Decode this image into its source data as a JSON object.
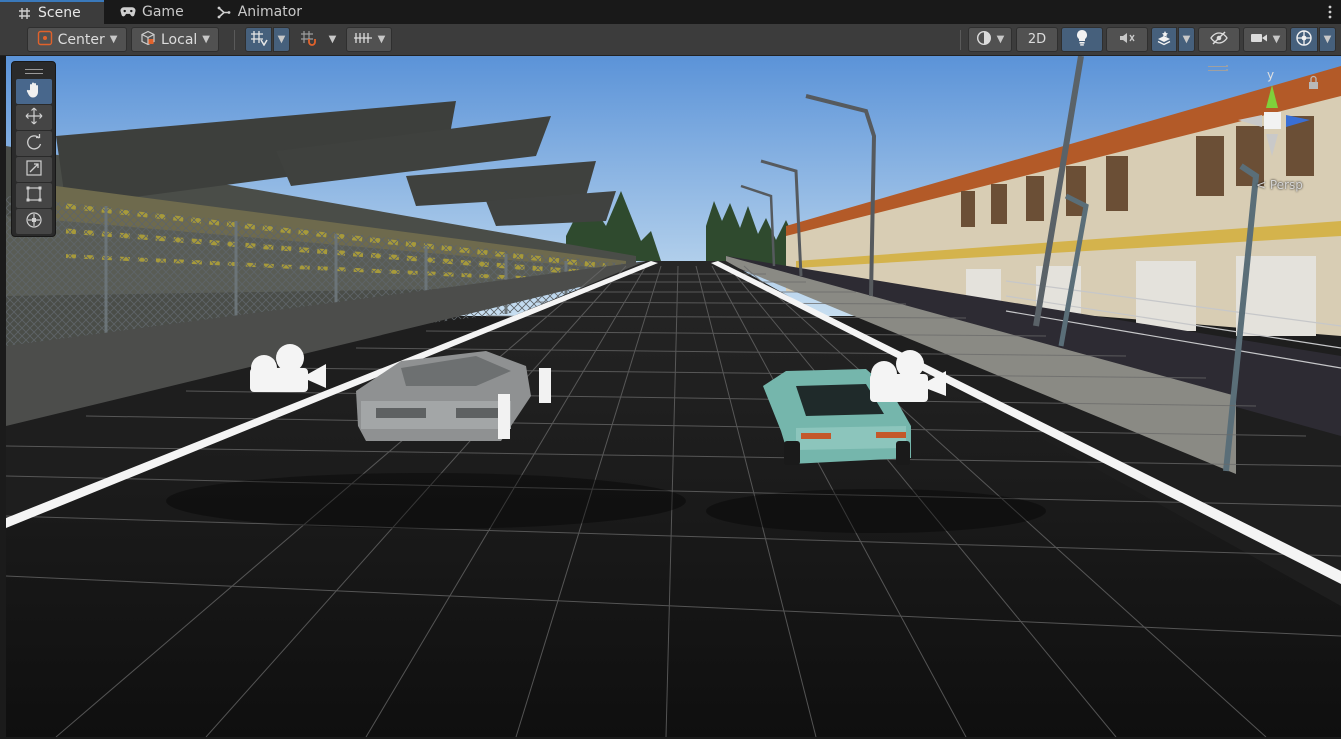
{
  "tabs": [
    {
      "label": "Scene",
      "icon": "hash-grid-icon",
      "active": true
    },
    {
      "label": "Game",
      "icon": "gamepad-icon",
      "active": false
    },
    {
      "label": "Animator",
      "icon": "animator-icon",
      "active": false
    }
  ],
  "toolbar": {
    "pivot_label": "Center",
    "space_label": "Local",
    "mode_2d_label": "2D"
  },
  "gizmo": {
    "axis_y_label": "y",
    "projection_label": "< Persp"
  },
  "colors": {
    "accent": "#3a79bb",
    "selected": "#48678c",
    "sky_top": "#5b93d8",
    "sky_bottom": "#bcd8ee",
    "track": "#141414",
    "wall": "#6a6a66",
    "car_teal": "#76b8ae",
    "car_grey": "#9a9a9a",
    "y_axis": "#7fd13b",
    "x_axis": "#d43a3a",
    "z_axis": "#3a6fd4"
  }
}
